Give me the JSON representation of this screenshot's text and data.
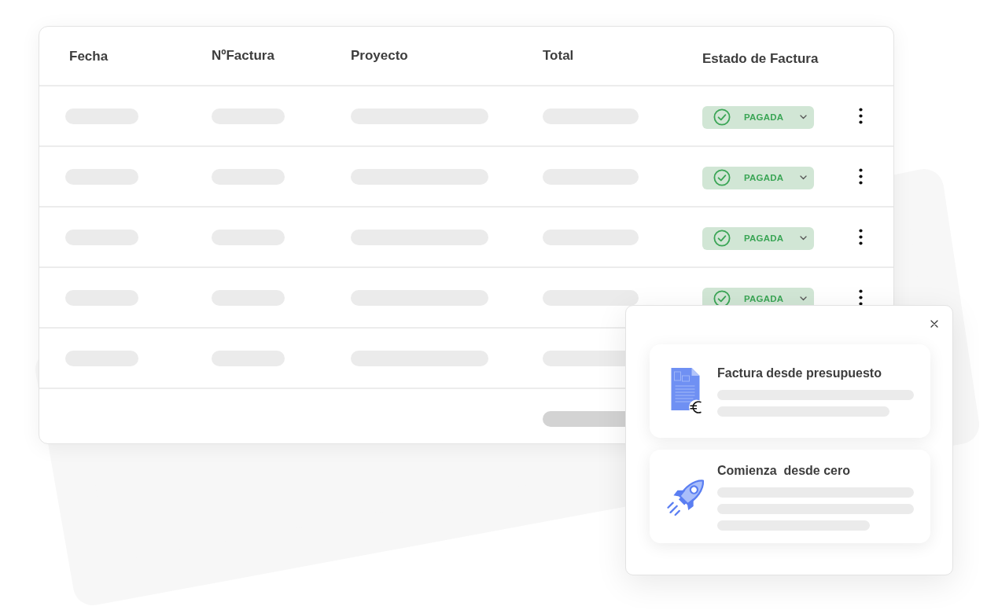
{
  "table": {
    "columns": [
      "Fecha",
      "NºFactura",
      "Proyecto",
      "Total",
      "Estado de Factura"
    ],
    "rows": [
      {
        "kind": "status",
        "status": "PAGADA"
      },
      {
        "kind": "status",
        "status": "PAGADA"
      },
      {
        "kind": "status",
        "status": "PAGADA"
      },
      {
        "kind": "status",
        "status": "PAGADA"
      },
      {
        "kind": "plain"
      }
    ]
  },
  "popup": {
    "options": [
      {
        "title": "Factura desde presupuesto"
      },
      {
        "title": "Comienza  desde cero"
      }
    ]
  }
}
